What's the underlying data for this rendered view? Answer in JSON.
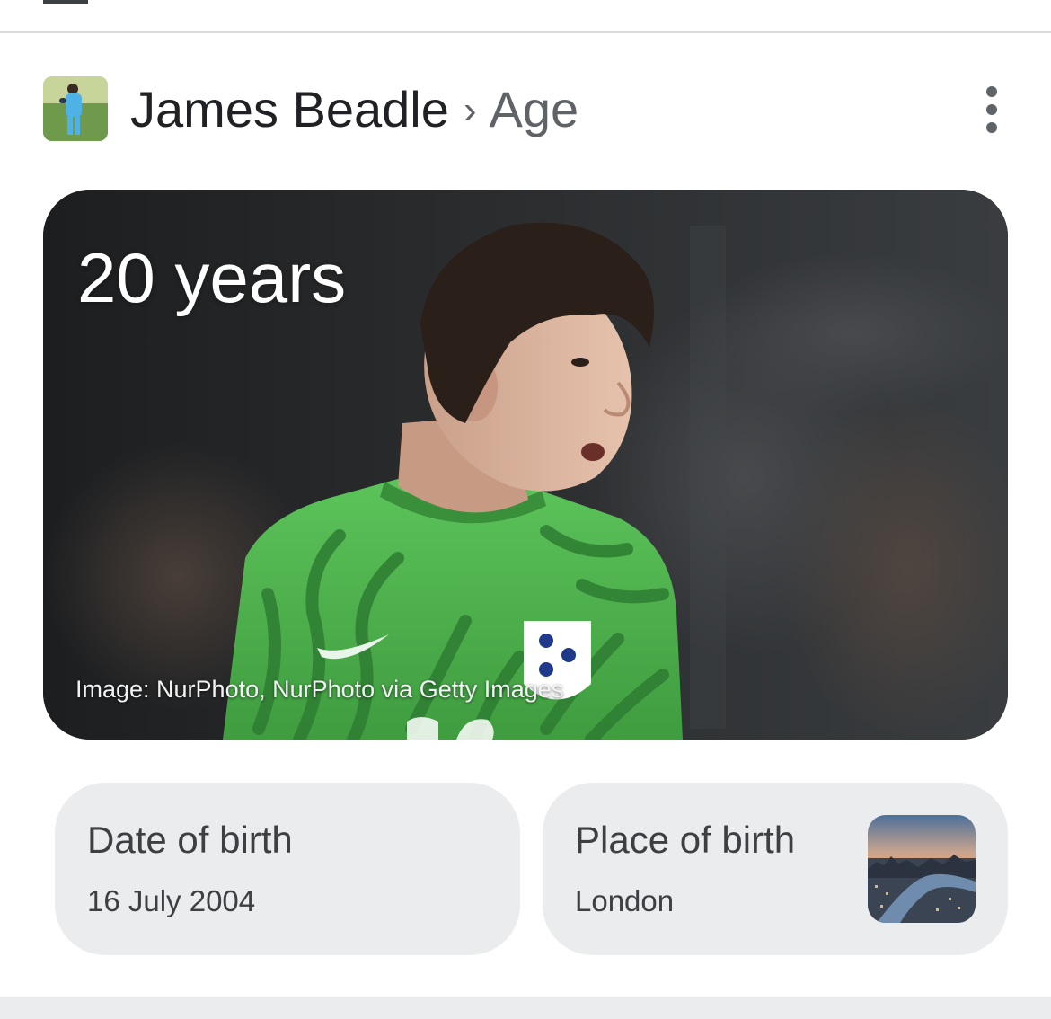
{
  "header": {
    "entity_name": "James Beadle",
    "separator": "›",
    "attribute": "Age",
    "avatar_icon": "player-thumbnail",
    "more_icon": "more-vert-icon"
  },
  "hero": {
    "age_text": "20 years",
    "image_credit": "Image: NurPhoto, NurPhoto via Getty Images"
  },
  "facts": [
    {
      "label": "Date of birth",
      "value": "16 July 2004"
    },
    {
      "label": "Place of birth",
      "value": "London",
      "thumbnail_icon": "london-cityscape-thumbnail"
    }
  ],
  "colors": {
    "card_bg": "#ebecee",
    "text_primary": "#202124",
    "text_secondary": "#5f6368",
    "kit_green": "#4caf50"
  }
}
